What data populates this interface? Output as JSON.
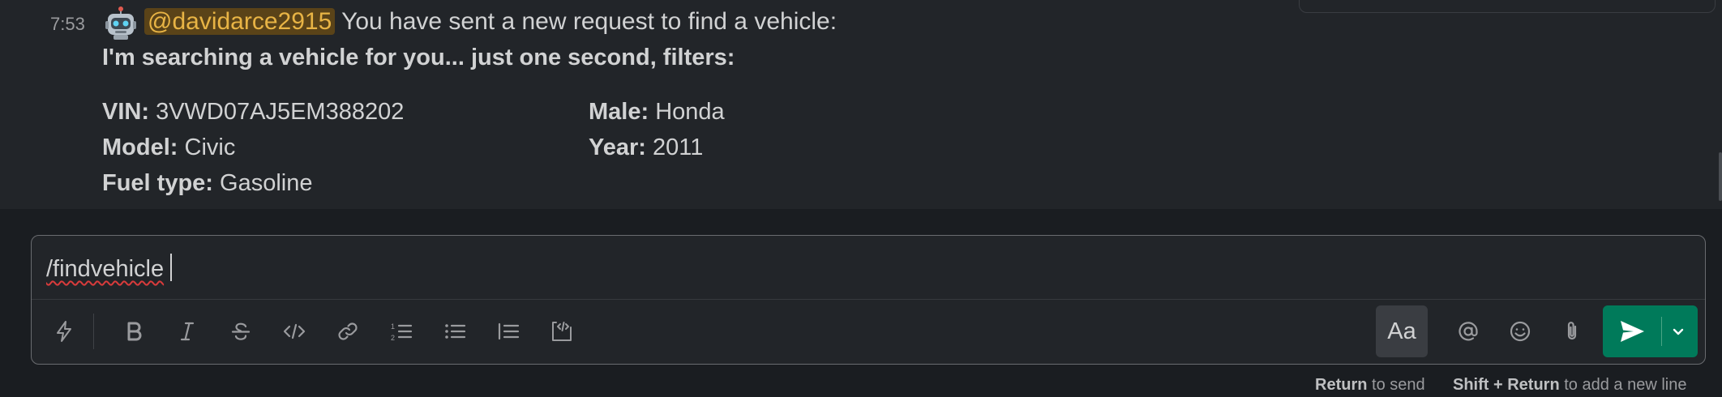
{
  "message": {
    "timestamp": "7:53",
    "avatar_icon": "robot-icon",
    "mention": "@davidarce2915",
    "intro_text": "You have sent a new request to find a vehicle:",
    "bold_line": "I'm searching a vehicle for you... just one second, filters:",
    "fields": {
      "vin_label": "VIN:",
      "vin_value": "3VWD07AJ5EM388202",
      "male_label": "Male:",
      "male_value": "Honda",
      "model_label": "Model:",
      "model_value": "Civic",
      "year_label": "Year:",
      "year_value": "2011",
      "fuel_label": "Fuel type:",
      "fuel_value": "Gasoline"
    }
  },
  "composer": {
    "input_value": "/findvehicle",
    "toolbar_icons": [
      "shortcuts-lightning-icon",
      "bold-icon",
      "italic-icon",
      "strikethrough-icon",
      "code-icon",
      "link-icon",
      "ordered-list-icon",
      "bulleted-list-icon",
      "blockquote-icon",
      "code-block-icon"
    ],
    "format_toggle_label": "Aa",
    "right_icons": [
      "mention-at-icon",
      "emoji-icon",
      "attach-paperclip-icon"
    ],
    "send_icon": "send-paper-plane-icon",
    "send_options_icon": "chevron-down-icon"
  },
  "hints": {
    "return_key": "Return",
    "return_text": "to send",
    "shift_return_key": "Shift + Return",
    "shift_return_text": "to add a new line"
  },
  "colors": {
    "background": "#1a1d21",
    "message_bg": "#222529",
    "mention_bg": "#5a4318",
    "mention_text": "#e8b445",
    "send_button": "#007a5a"
  }
}
